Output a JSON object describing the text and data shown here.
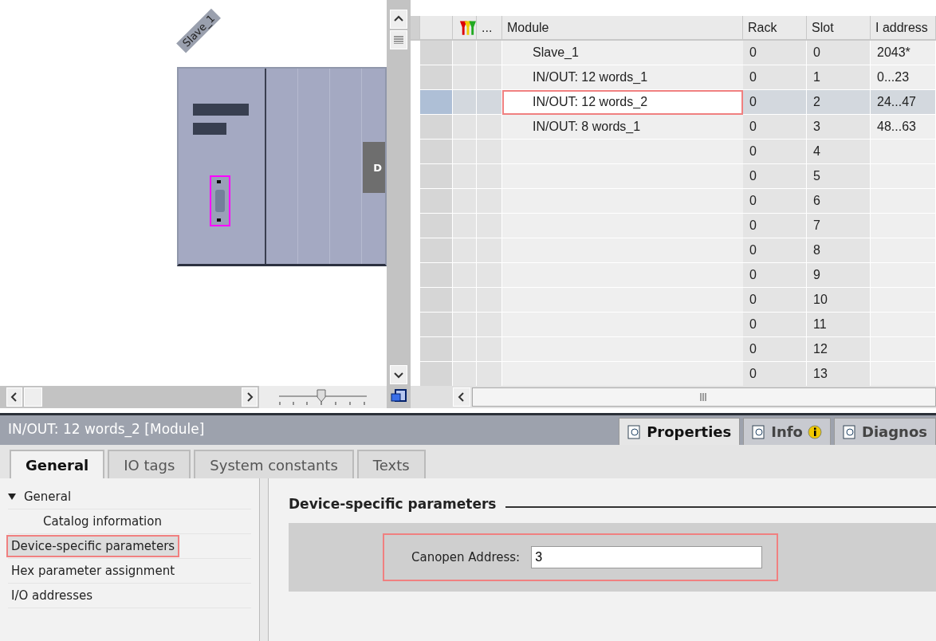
{
  "device_view": {
    "device_label": "Slave_1",
    "module_letter": "D",
    "zoom_slider": {
      "level": 0.5
    }
  },
  "table": {
    "columns": [
      "Module",
      "Rack",
      "Slot",
      "I address"
    ],
    "rows": [
      {
        "module": "Slave_1",
        "rack": "0",
        "slot": "0",
        "i_address": "2043*",
        "selected": false
      },
      {
        "module": "IN/OUT: 12 words_1",
        "rack": "0",
        "slot": "1",
        "i_address": "0...23",
        "selected": false
      },
      {
        "module": "IN/OUT: 12 words_2",
        "rack": "0",
        "slot": "2",
        "i_address": "24...47",
        "selected": true
      },
      {
        "module": "IN/OUT: 8 words_1",
        "rack": "0",
        "slot": "3",
        "i_address": "48...63",
        "selected": false
      },
      {
        "module": "",
        "rack": "0",
        "slot": "4",
        "i_address": "",
        "selected": false
      },
      {
        "module": "",
        "rack": "0",
        "slot": "5",
        "i_address": "",
        "selected": false
      },
      {
        "module": "",
        "rack": "0",
        "slot": "6",
        "i_address": "",
        "selected": false
      },
      {
        "module": "",
        "rack": "0",
        "slot": "7",
        "i_address": "",
        "selected": false
      },
      {
        "module": "",
        "rack": "0",
        "slot": "8",
        "i_address": "",
        "selected": false
      },
      {
        "module": "",
        "rack": "0",
        "slot": "9",
        "i_address": "",
        "selected": false
      },
      {
        "module": "",
        "rack": "0",
        "slot": "10",
        "i_address": "",
        "selected": false
      },
      {
        "module": "",
        "rack": "0",
        "slot": "11",
        "i_address": "",
        "selected": false
      },
      {
        "module": "",
        "rack": "0",
        "slot": "12",
        "i_address": "",
        "selected": false
      },
      {
        "module": "",
        "rack": "0",
        "slot": "13",
        "i_address": "",
        "selected": false
      }
    ],
    "more_columns": "..."
  },
  "inspector": {
    "title": "IN/OUT: 12 words_2 [Module]",
    "view_tabs": [
      {
        "label": "Properties",
        "selected": true
      },
      {
        "label": "Info",
        "selected": false
      },
      {
        "label": "Diagnos",
        "selected": false
      }
    ],
    "tabs": [
      {
        "label": "General",
        "selected": true
      },
      {
        "label": "IO tags",
        "selected": false
      },
      {
        "label": "System constants",
        "selected": false
      },
      {
        "label": "Texts",
        "selected": false
      }
    ],
    "nav": [
      {
        "label": "General",
        "expanded": true,
        "selected": false,
        "children": [
          {
            "label": "Catalog information",
            "selected": false
          }
        ]
      },
      {
        "label": "Device-specific parameters",
        "selected": true
      },
      {
        "label": "Hex parameter assignment",
        "selected": false
      },
      {
        "label": "I/O addresses",
        "selected": false
      }
    ],
    "section_title": "Device-specific parameters",
    "field": {
      "label": "Canopen Address:",
      "value": "3"
    }
  }
}
